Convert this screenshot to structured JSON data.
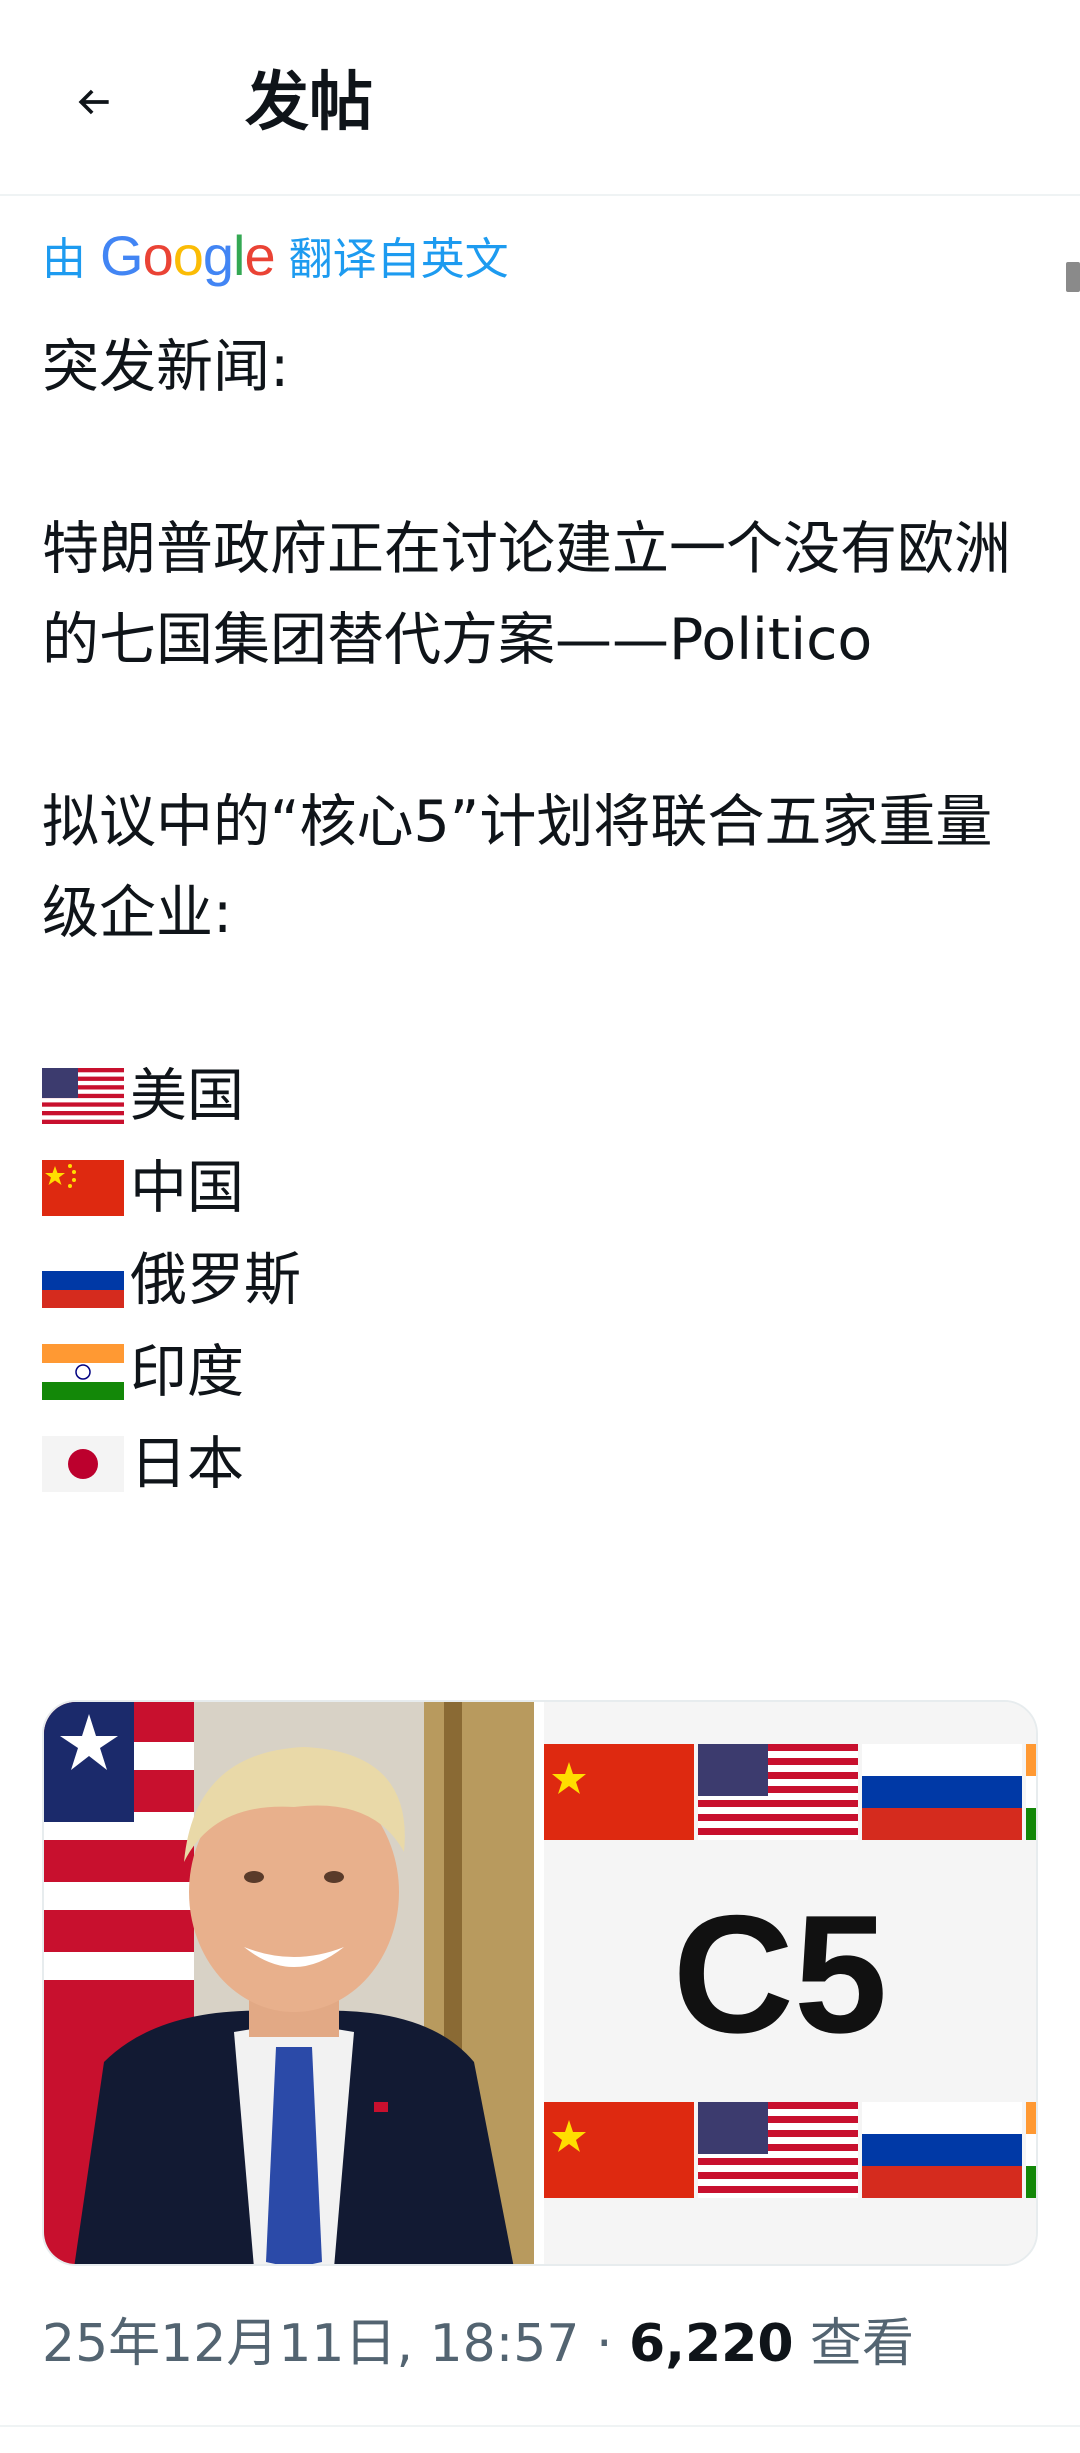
{
  "header": {
    "title": "发帖"
  },
  "translation": {
    "prefix": "由",
    "brand": "Google",
    "suffix": "翻译自英文"
  },
  "post": {
    "heading": "突发新闻:",
    "paragraph1": "特朗普政府正在讨论建立一个没有欧洲的七国集团替代方案——Politico",
    "paragraph2": "拟议中的“核心5”计划将联合五家重量级企业:",
    "countries": [
      {
        "flag": "us-flag",
        "name": "美国"
      },
      {
        "flag": "cn-flag",
        "name": "中国"
      },
      {
        "flag": "ru-flag",
        "name": "俄罗斯"
      },
      {
        "flag": "in-flag",
        "name": "印度"
      },
      {
        "flag": "jp-flag",
        "name": "日本"
      }
    ]
  },
  "media": {
    "c5_text": "C5"
  },
  "meta": {
    "timestamp": "25年12月11日, 18:57",
    "separator": " · ",
    "views": "6,220",
    "views_label": " 查看"
  },
  "colors": {
    "accent": "#1d9bf0",
    "text": "#0f1419",
    "secondary": "#536471"
  }
}
